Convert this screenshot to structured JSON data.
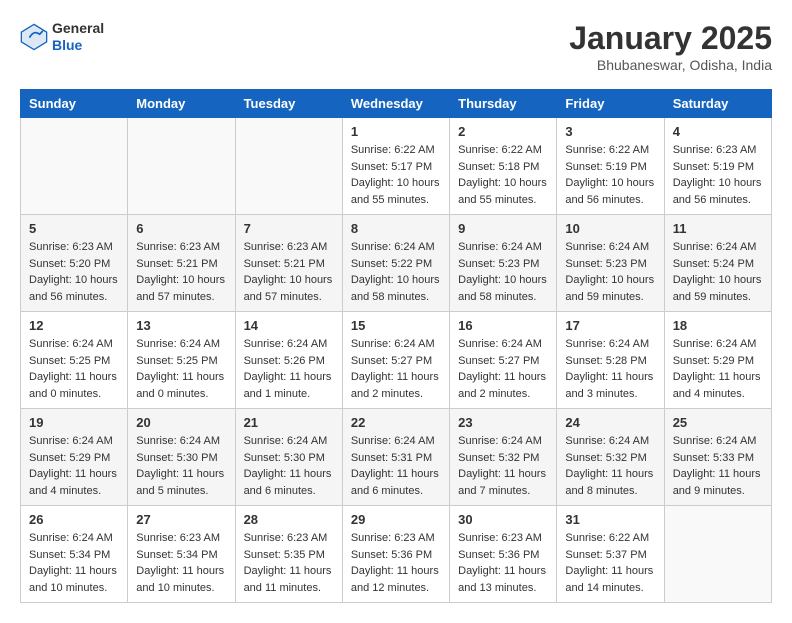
{
  "header": {
    "logo_general": "General",
    "logo_blue": "Blue",
    "title": "January 2025",
    "location": "Bhubaneswar, Odisha, India"
  },
  "weekdays": [
    "Sunday",
    "Monday",
    "Tuesday",
    "Wednesday",
    "Thursday",
    "Friday",
    "Saturday"
  ],
  "weeks": [
    [
      {
        "day": "",
        "info": ""
      },
      {
        "day": "",
        "info": ""
      },
      {
        "day": "",
        "info": ""
      },
      {
        "day": "1",
        "info": "Sunrise: 6:22 AM\nSunset: 5:17 PM\nDaylight: 10 hours\nand 55 minutes."
      },
      {
        "day": "2",
        "info": "Sunrise: 6:22 AM\nSunset: 5:18 PM\nDaylight: 10 hours\nand 55 minutes."
      },
      {
        "day": "3",
        "info": "Sunrise: 6:22 AM\nSunset: 5:19 PM\nDaylight: 10 hours\nand 56 minutes."
      },
      {
        "day": "4",
        "info": "Sunrise: 6:23 AM\nSunset: 5:19 PM\nDaylight: 10 hours\nand 56 minutes."
      }
    ],
    [
      {
        "day": "5",
        "info": "Sunrise: 6:23 AM\nSunset: 5:20 PM\nDaylight: 10 hours\nand 56 minutes."
      },
      {
        "day": "6",
        "info": "Sunrise: 6:23 AM\nSunset: 5:21 PM\nDaylight: 10 hours\nand 57 minutes."
      },
      {
        "day": "7",
        "info": "Sunrise: 6:23 AM\nSunset: 5:21 PM\nDaylight: 10 hours\nand 57 minutes."
      },
      {
        "day": "8",
        "info": "Sunrise: 6:24 AM\nSunset: 5:22 PM\nDaylight: 10 hours\nand 58 minutes."
      },
      {
        "day": "9",
        "info": "Sunrise: 6:24 AM\nSunset: 5:23 PM\nDaylight: 10 hours\nand 58 minutes."
      },
      {
        "day": "10",
        "info": "Sunrise: 6:24 AM\nSunset: 5:23 PM\nDaylight: 10 hours\nand 59 minutes."
      },
      {
        "day": "11",
        "info": "Sunrise: 6:24 AM\nSunset: 5:24 PM\nDaylight: 10 hours\nand 59 minutes."
      }
    ],
    [
      {
        "day": "12",
        "info": "Sunrise: 6:24 AM\nSunset: 5:25 PM\nDaylight: 11 hours\nand 0 minutes."
      },
      {
        "day": "13",
        "info": "Sunrise: 6:24 AM\nSunset: 5:25 PM\nDaylight: 11 hours\nand 0 minutes."
      },
      {
        "day": "14",
        "info": "Sunrise: 6:24 AM\nSunset: 5:26 PM\nDaylight: 11 hours\nand 1 minute."
      },
      {
        "day": "15",
        "info": "Sunrise: 6:24 AM\nSunset: 5:27 PM\nDaylight: 11 hours\nand 2 minutes."
      },
      {
        "day": "16",
        "info": "Sunrise: 6:24 AM\nSunset: 5:27 PM\nDaylight: 11 hours\nand 2 minutes."
      },
      {
        "day": "17",
        "info": "Sunrise: 6:24 AM\nSunset: 5:28 PM\nDaylight: 11 hours\nand 3 minutes."
      },
      {
        "day": "18",
        "info": "Sunrise: 6:24 AM\nSunset: 5:29 PM\nDaylight: 11 hours\nand 4 minutes."
      }
    ],
    [
      {
        "day": "19",
        "info": "Sunrise: 6:24 AM\nSunset: 5:29 PM\nDaylight: 11 hours\nand 4 minutes."
      },
      {
        "day": "20",
        "info": "Sunrise: 6:24 AM\nSunset: 5:30 PM\nDaylight: 11 hours\nand 5 minutes."
      },
      {
        "day": "21",
        "info": "Sunrise: 6:24 AM\nSunset: 5:30 PM\nDaylight: 11 hours\nand 6 minutes."
      },
      {
        "day": "22",
        "info": "Sunrise: 6:24 AM\nSunset: 5:31 PM\nDaylight: 11 hours\nand 6 minutes."
      },
      {
        "day": "23",
        "info": "Sunrise: 6:24 AM\nSunset: 5:32 PM\nDaylight: 11 hours\nand 7 minutes."
      },
      {
        "day": "24",
        "info": "Sunrise: 6:24 AM\nSunset: 5:32 PM\nDaylight: 11 hours\nand 8 minutes."
      },
      {
        "day": "25",
        "info": "Sunrise: 6:24 AM\nSunset: 5:33 PM\nDaylight: 11 hours\nand 9 minutes."
      }
    ],
    [
      {
        "day": "26",
        "info": "Sunrise: 6:24 AM\nSunset: 5:34 PM\nDaylight: 11 hours\nand 10 minutes."
      },
      {
        "day": "27",
        "info": "Sunrise: 6:23 AM\nSunset: 5:34 PM\nDaylight: 11 hours\nand 10 minutes."
      },
      {
        "day": "28",
        "info": "Sunrise: 6:23 AM\nSunset: 5:35 PM\nDaylight: 11 hours\nand 11 minutes."
      },
      {
        "day": "29",
        "info": "Sunrise: 6:23 AM\nSunset: 5:36 PM\nDaylight: 11 hours\nand 12 minutes."
      },
      {
        "day": "30",
        "info": "Sunrise: 6:23 AM\nSunset: 5:36 PM\nDaylight: 11 hours\nand 13 minutes."
      },
      {
        "day": "31",
        "info": "Sunrise: 6:22 AM\nSunset: 5:37 PM\nDaylight: 11 hours\nand 14 minutes."
      },
      {
        "day": "",
        "info": ""
      }
    ]
  ]
}
